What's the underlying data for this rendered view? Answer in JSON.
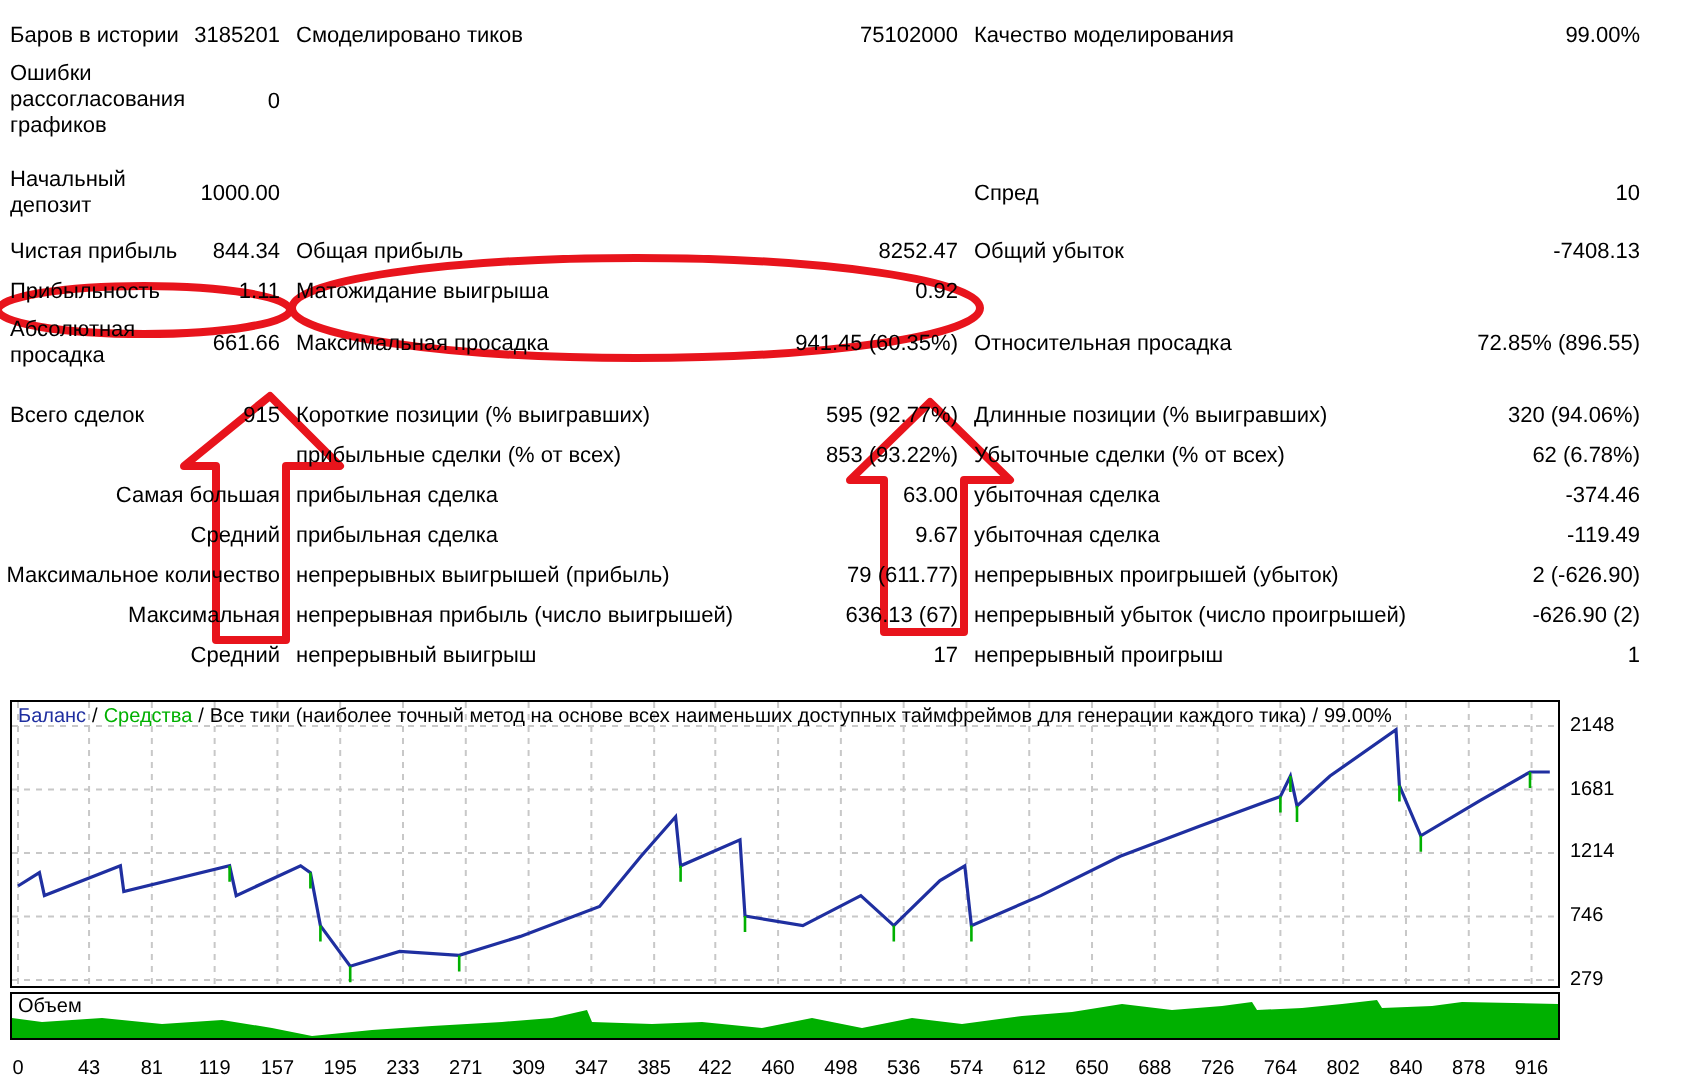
{
  "report": {
    "rows": [
      [
        {
          "label": "Баров в истории",
          "value": "3185201"
        },
        {
          "label": "Смоделировано тиков",
          "value": "75102000"
        },
        {
          "label": "Качество моделирования",
          "value": "99.00%"
        }
      ],
      [
        {
          "label": "Ошибки рассогласования графиков",
          "value": "0"
        },
        null,
        null
      ],
      [
        {
          "label": "Начальный депозит",
          "value": "1000.00"
        },
        null,
        {
          "label": "Спред",
          "value": "10"
        }
      ],
      [
        {
          "label": "Чистая прибыль",
          "value": "844.34"
        },
        {
          "label": "Общая прибыль",
          "value": "8252.47"
        },
        {
          "label": "Общий убыток",
          "value": "-7408.13"
        }
      ],
      [
        {
          "label": "Прибыльность",
          "value": "1.11"
        },
        {
          "label": "Матожидание выигрыша",
          "value": "0.92"
        },
        null
      ],
      [
        {
          "label": "Абсолютная просадка",
          "value": "661.66"
        },
        {
          "label": "Максимальная просадка",
          "value": "941.45 (60.35%)"
        },
        {
          "label": "Относительная просадка",
          "value": "72.85% (896.55)"
        }
      ],
      [
        {
          "label": "Всего сделок",
          "value": "915"
        },
        {
          "label": "Короткие позиции (% выигравших)",
          "value": "595 (92.77%)"
        },
        {
          "label": "Длинные позиции (% выигравших)",
          "value": "320 (94.06%)"
        }
      ],
      [
        null,
        {
          "label": "прибыльные сделки (% от всех)",
          "value": "853 (93.22%)"
        },
        {
          "label": "Убыточные сделки (% от всех)",
          "value": "62 (6.78%)"
        }
      ],
      [
        {
          "label": "Самая большая"
        },
        {
          "label": "прибыльная сделка",
          "value": "63.00"
        },
        {
          "label": "убыточная сделка",
          "value": "-374.46"
        }
      ],
      [
        {
          "label": "Средний"
        },
        {
          "label": "прибыльная сделка",
          "value": "9.67"
        },
        {
          "label": "убыточная сделка",
          "value": "-119.49"
        }
      ],
      [
        {
          "label": "Максимальное количество"
        },
        {
          "label": "непрерывных выигрышей (прибыль)",
          "value": "79 (611.77)"
        },
        {
          "label": "непрерывных проигрышей (убыток)",
          "value": "2 (-626.90)"
        }
      ],
      [
        {
          "label": "Максимальная"
        },
        {
          "label": "непрерывная прибыль (число выигрышей)",
          "value": "636.13 (67)"
        },
        {
          "label": "непрерывный убыток (число проигрышей)",
          "value": "-626.90 (2)"
        }
      ],
      [
        {
          "label": "Средний"
        },
        {
          "label": "непрерывный выигрыш",
          "value": "17"
        },
        {
          "label": "непрерывный проигрыш",
          "value": "1"
        }
      ]
    ]
  },
  "chart": {
    "separators": [
      "/",
      "/",
      "/"
    ],
    "equity_legend": {
      "text": "Средства",
      "color": "#00b000"
    },
    "mode": "Все тики (наиболее точный метод на основе всех наименьших доступных таймфреймов для генерации каждого тика)",
    "quality": "99.00%",
    "chart_data": {
      "type": "line",
      "xlim": [
        0,
        932
      ],
      "ylim": [
        279,
        2148
      ],
      "grid": true,
      "x": [
        0,
        13,
        16,
        62,
        64,
        128,
        132,
        171,
        177,
        183,
        201,
        231,
        267,
        304,
        352,
        377,
        398,
        401,
        437,
        440,
        475,
        510,
        530,
        558,
        573,
        577,
        619,
        667,
        715,
        764,
        770,
        774,
        794,
        834,
        836,
        849,
        885,
        915,
        927
      ],
      "xticks": [
        0,
        43,
        81,
        119,
        157,
        195,
        233,
        271,
        309,
        347,
        385,
        422,
        460,
        498,
        536,
        574,
        612,
        650,
        688,
        726,
        764,
        802,
        840,
        878,
        916
      ],
      "yticks": [
        279,
        746,
        1214,
        1681,
        2148
      ],
      "series": [
        {
          "name": "Баланс",
          "color": "#1f2fa0",
          "values": [
            970,
            1070,
            900,
            1120,
            930,
            1120,
            900,
            1120,
            1070,
            680,
            380,
            490,
            460,
            600,
            820,
            1190,
            1480,
            1120,
            1310,
            750,
            680,
            900,
            680,
            1010,
            1120,
            680,
            900,
            1190,
            1410,
            1630,
            1780,
            1560,
            1780,
            2120,
            1710,
            1340,
            1600,
            1810,
            1810
          ]
        }
      ]
    },
    "volume": {
      "label": "Объем"
    }
  },
  "annotations": [
    {
      "kind": "ellipse"
    },
    {
      "kind": "ellipse"
    },
    {
      "kind": "arrow"
    },
    {
      "kind": "arrow"
    }
  ]
}
